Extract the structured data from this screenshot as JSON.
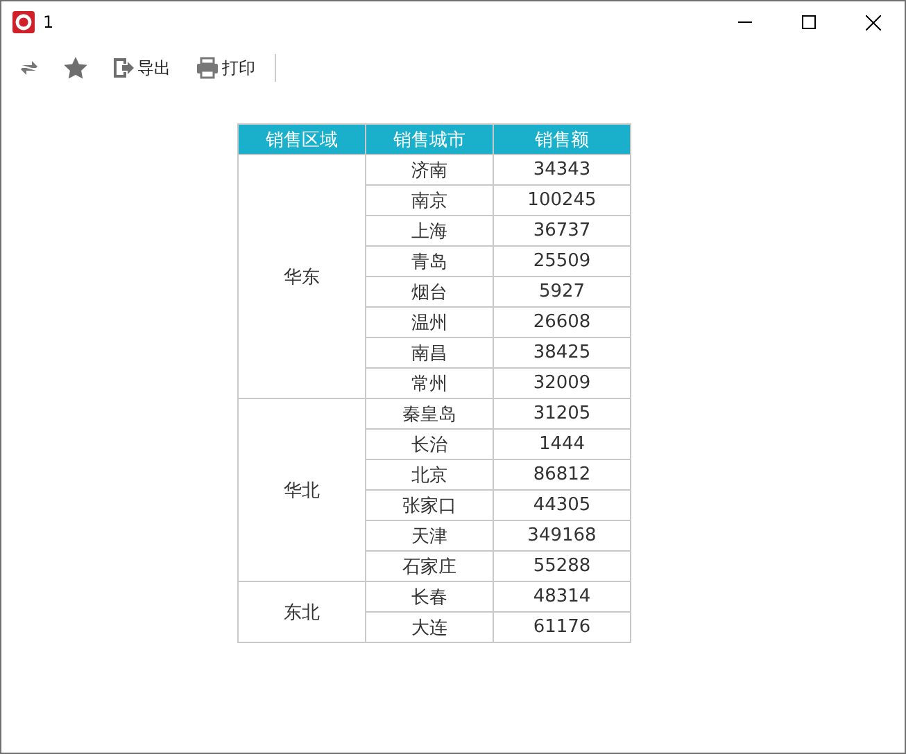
{
  "window": {
    "title": "1"
  },
  "toolbar": [
    {
      "kind": "refresh"
    },
    {
      "kind": "star"
    },
    {
      "kind": "export",
      "label": "导出"
    },
    {
      "kind": "print",
      "label": "打印"
    }
  ],
  "table": {
    "columns": [
      "销售区域",
      "销售城市",
      "销售额"
    ],
    "groups": [
      {
        "region": "华东",
        "rows": [
          [
            "济南",
            "34343"
          ],
          [
            "南京",
            "100245"
          ],
          [
            "上海",
            "36737"
          ],
          [
            "青岛",
            "25509"
          ],
          [
            "烟台",
            "5927"
          ],
          [
            "温州",
            "26608"
          ],
          [
            "南昌",
            "38425"
          ],
          [
            "常州",
            "32009"
          ]
        ]
      },
      {
        "region": "华北",
        "rows": [
          [
            "秦皇岛",
            "31205"
          ],
          [
            "长治",
            "1444"
          ],
          [
            "北京",
            "86812"
          ],
          [
            "张家口",
            "44305"
          ],
          [
            "天津",
            "349168"
          ],
          [
            "石家庄",
            "55288"
          ]
        ]
      },
      {
        "region": "东北",
        "rows": [
          [
            "长春",
            "48314"
          ],
          [
            "大连",
            "61176"
          ]
        ]
      }
    ]
  }
}
